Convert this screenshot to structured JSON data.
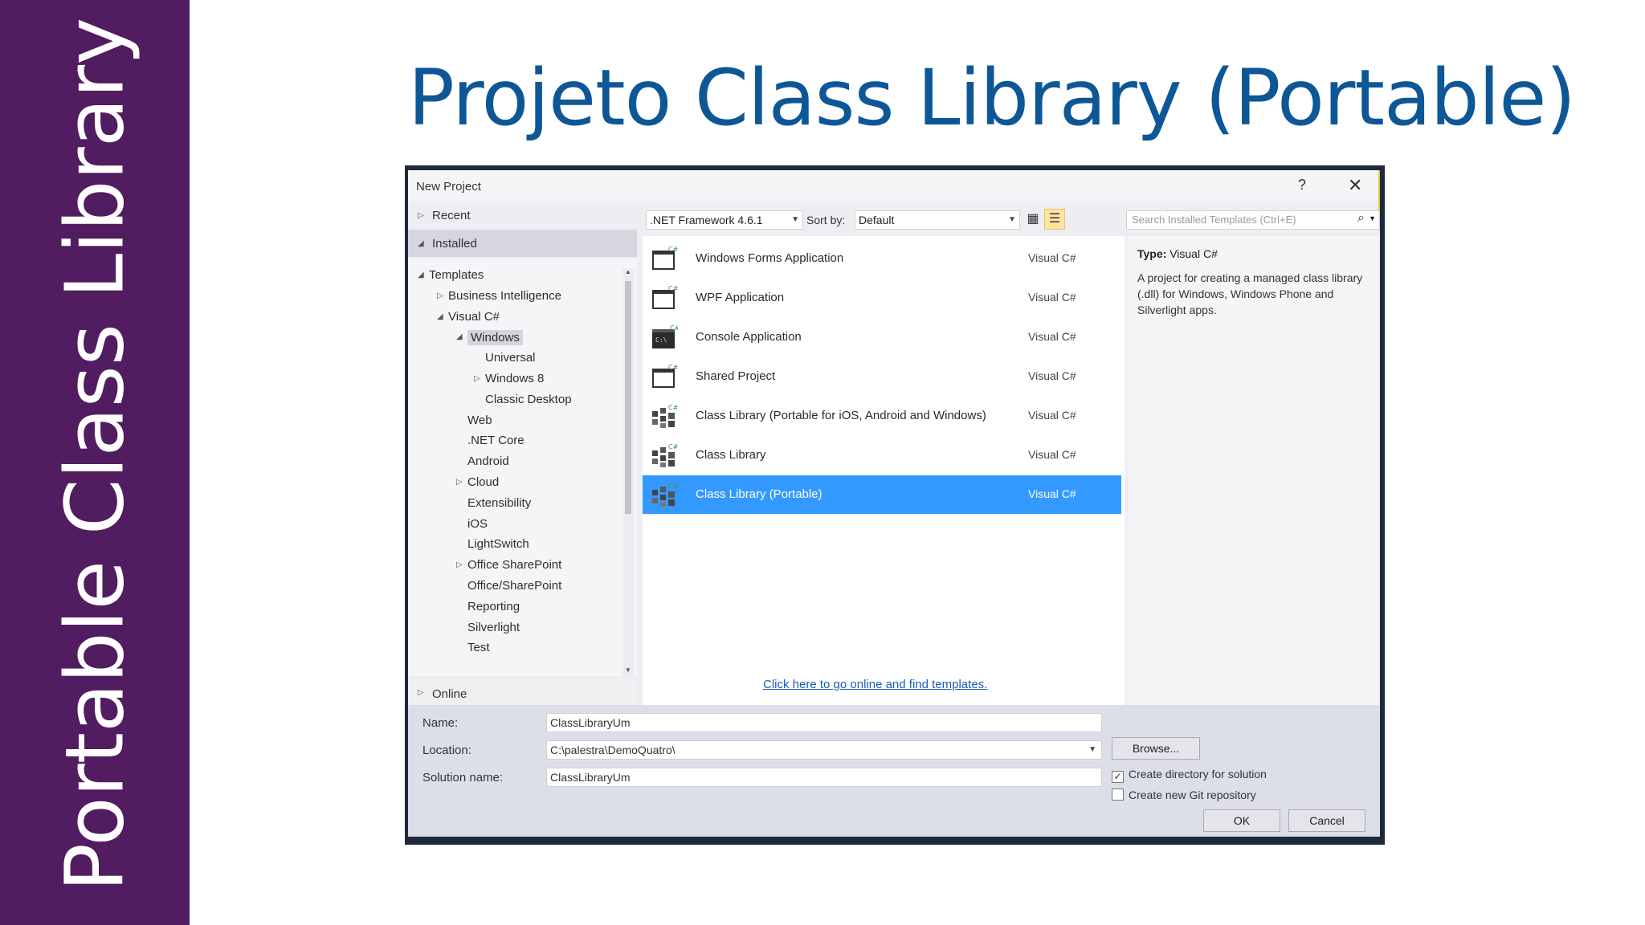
{
  "slide": {
    "side_title": "Portable Class Library",
    "title": "Projeto Class Library (Portable)"
  },
  "dialog": {
    "title": "New Project",
    "help": "?",
    "close": "✕",
    "nav": {
      "recent": "Recent",
      "installed": "Installed",
      "online": "Online"
    },
    "tree": [
      {
        "label": "Templates",
        "level": 0,
        "arrow": "expanded"
      },
      {
        "label": "Business Intelligence",
        "level": 1,
        "arrow": "collapsed"
      },
      {
        "label": "Visual C#",
        "level": 1,
        "arrow": "expanded"
      },
      {
        "label": "Windows",
        "level": 2,
        "arrow": "expanded",
        "selected": true
      },
      {
        "label": "Universal",
        "level": 3,
        "arrow": ""
      },
      {
        "label": "Windows 8",
        "level": 3,
        "arrow": "collapsed"
      },
      {
        "label": "Classic Desktop",
        "level": 3,
        "arrow": ""
      },
      {
        "label": "Web",
        "level": 2,
        "arrow": ""
      },
      {
        "label": ".NET Core",
        "level": 2,
        "arrow": ""
      },
      {
        "label": "Android",
        "level": 2,
        "arrow": ""
      },
      {
        "label": "Cloud",
        "level": 2,
        "arrow": "collapsed"
      },
      {
        "label": "Extensibility",
        "level": 2,
        "arrow": ""
      },
      {
        "label": "iOS",
        "level": 2,
        "arrow": ""
      },
      {
        "label": "LightSwitch",
        "level": 2,
        "arrow": ""
      },
      {
        "label": "Office SharePoint",
        "level": 2,
        "arrow": "collapsed"
      },
      {
        "label": "Office/SharePoint",
        "level": 2,
        "arrow": ""
      },
      {
        "label": "Reporting",
        "level": 2,
        "arrow": ""
      },
      {
        "label": "Silverlight",
        "level": 2,
        "arrow": ""
      },
      {
        "label": "Test",
        "level": 2,
        "arrow": ""
      }
    ],
    "toolbar": {
      "framework": ".NET Framework 4.6.1",
      "sort_label": "Sort by:",
      "sort_value": "Default",
      "search_placeholder": "Search Installed Templates (Ctrl+E)"
    },
    "templates": [
      {
        "name": "Windows Forms Application",
        "lang": "Visual C#",
        "icon": "windows-forms-icon"
      },
      {
        "name": "WPF Application",
        "lang": "Visual C#",
        "icon": "wpf-icon"
      },
      {
        "name": "Console Application",
        "lang": "Visual C#",
        "icon": "console-icon"
      },
      {
        "name": "Shared Project",
        "lang": "Visual C#",
        "icon": "shared-project-icon"
      },
      {
        "name": "Class Library (Portable for iOS, Android and Windows)",
        "lang": "Visual C#",
        "icon": "class-library-icon"
      },
      {
        "name": "Class Library",
        "lang": "Visual C#",
        "icon": "class-library-icon"
      },
      {
        "name": "Class Library (Portable)",
        "lang": "Visual C#",
        "icon": "class-library-icon",
        "selected": true
      }
    ],
    "online_link": "Click here to go online and find templates.",
    "details": {
      "type_label": "Type:",
      "type_value": "Visual C#",
      "description": "A project for creating a managed class library (.dll) for Windows, Windows Phone and Silverlight apps."
    },
    "form": {
      "name_label": "Name:",
      "name_value": "ClassLibraryUm",
      "location_label": "Location:",
      "location_value": "C:\\palestra\\DemoQuatro\\",
      "solution_label": "Solution name:",
      "solution_value": "ClassLibraryUm",
      "browse": "Browse...",
      "create_dir": "Create directory for solution",
      "create_dir_checked": true,
      "create_git": "Create new Git repository",
      "create_git_checked": false,
      "ok": "OK",
      "cancel": "Cancel"
    }
  }
}
